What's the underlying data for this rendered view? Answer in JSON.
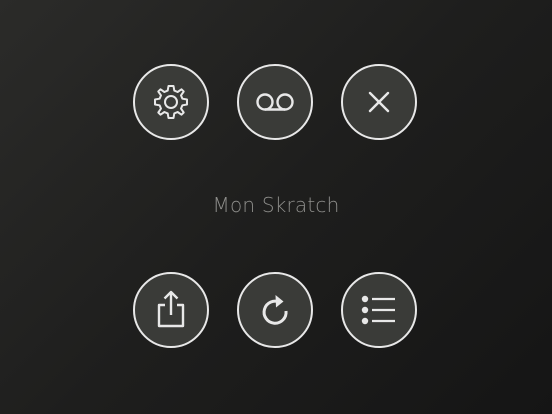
{
  "title": "Mon Skratch",
  "buttons": {
    "top_row": [
      {
        "name": "settings-button",
        "icon": "gear-icon"
      },
      {
        "name": "voicemail-button",
        "icon": "voicemail-icon"
      },
      {
        "name": "close-button",
        "icon": "close-icon"
      }
    ],
    "bottom_row": [
      {
        "name": "share-button",
        "icon": "share-icon"
      },
      {
        "name": "refresh-button",
        "icon": "refresh-icon"
      },
      {
        "name": "list-button",
        "icon": "list-icon"
      }
    ]
  },
  "colors": {
    "background": "#232322",
    "button_fill": "#3a3b38",
    "button_stroke": "#e8e8e8",
    "title_text": "#8e8e8b"
  }
}
